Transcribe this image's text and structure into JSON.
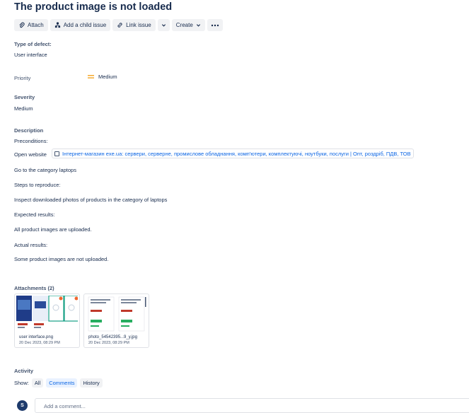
{
  "issue": {
    "title": "The product image is not loaded"
  },
  "toolbar": {
    "attach": "Attach",
    "add_child": "Add a child issue",
    "link_issue": "Link issue",
    "create": "Create"
  },
  "fields": {
    "type_label": "Type of defect:",
    "type_value": "User interface",
    "priority_label": "Priority",
    "priority_value": "Medium",
    "severity_label": "Severity",
    "severity_value": "Medium"
  },
  "description": {
    "label": "Description",
    "preconditions": "Preconditions:",
    "open_website": "Open website",
    "link_text": "Інтернет-магазин exe.ua: сервери, серверне, промислове обладнання, комп'ютери, комплектуючі, ноутбуки, послуги | Опт, роздріб, ПДВ, ТОВ",
    "go_to": "Go to the category laptops",
    "steps": "Steps to reproduce:",
    "inspect": "Inspect downloaded photos of products in the category of laptops",
    "expected_label": "Expected results:",
    "expected_value": "All product images are uploaded.",
    "actual_label": "Actual results:",
    "actual_value": "Some product images are not uploaded."
  },
  "attachments": {
    "label": "Attachments (2)",
    "items": [
      {
        "name": "user interface.png",
        "date": "20 Dec 2023, 08:29 PM"
      },
      {
        "name": "photo_54542395...9_y.jpg",
        "date": "20 Dec 2023, 08:29 PM"
      }
    ]
  },
  "activity": {
    "label": "Activity",
    "show": "Show:",
    "tabs": [
      "All",
      "Comments",
      "History"
    ],
    "active_tab": "Comments",
    "avatar_initial": "S",
    "comment_placeholder": "Add a comment..."
  },
  "colors": {
    "priority": "#f5a623",
    "link": "#0c66e4",
    "accent": "#e9f2ff"
  },
  "icons": [
    "paperclip-icon",
    "child-issue-icon",
    "link-icon",
    "chevron-down-icon",
    "more-icon",
    "priority-medium-icon",
    "webpage-icon"
  ]
}
